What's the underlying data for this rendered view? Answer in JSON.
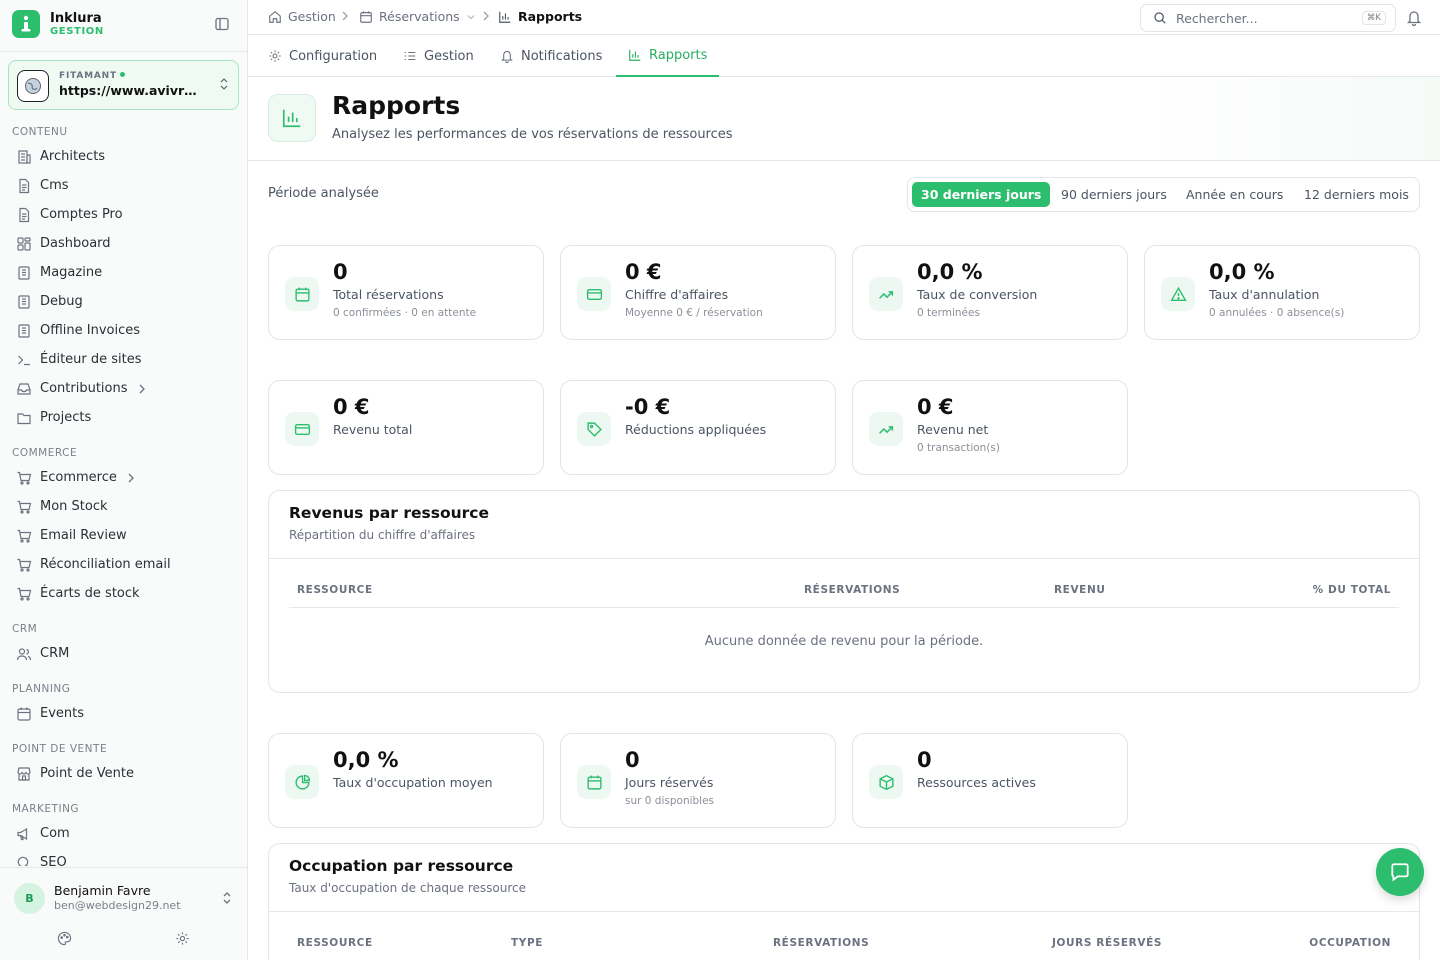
{
  "brand": {
    "name": "Inklura",
    "subtitle": "GESTION"
  },
  "site": {
    "label": "FITAMANT",
    "url": "https://www.avivre.fr"
  },
  "nav": {
    "sections": [
      {
        "title": "CONTENU",
        "items": [
          "Architects",
          "Cms",
          "Comptes Pro",
          "Dashboard",
          "Magazine",
          "Debug",
          "Offline Invoices",
          "Éditeur de sites",
          "Contributions",
          "Projects"
        ]
      },
      {
        "title": "COMMERCE",
        "items": [
          "Ecommerce",
          "Mon Stock",
          "Email Review",
          "Réconciliation email",
          "Écarts de stock"
        ]
      },
      {
        "title": "CRM",
        "items": [
          "CRM"
        ]
      },
      {
        "title": "PLANNING",
        "items": [
          "Events"
        ]
      },
      {
        "title": "POINT DE VENTE",
        "items": [
          "Point de Vente"
        ]
      },
      {
        "title": "MARKETING",
        "items": [
          "Com",
          "SEO"
        ]
      }
    ]
  },
  "user": {
    "initial": "B",
    "name": "Benjamin Favre",
    "email": "ben@webdesign29.net"
  },
  "breadcrumb": {
    "home": "Gestion",
    "section": "Réservations",
    "current": "Rapports"
  },
  "search": {
    "placeholder": "Rechercher...",
    "shortcut": "⌘K"
  },
  "tabs": [
    "Configuration",
    "Gestion",
    "Notifications",
    "Rapports"
  ],
  "header": {
    "title": "Rapports",
    "subtitle": "Analysez les performances de vos réservations de ressources"
  },
  "period": {
    "label": "Période analysée",
    "options": [
      "30 derniers jours",
      "90 derniers jours",
      "Année en cours",
      "12 derniers mois"
    ],
    "selected": "30 derniers jours"
  },
  "stats_row1": [
    {
      "value": "0",
      "label": "Total réservations",
      "sub": "0 confirmées · 0 en attente",
      "icon": "calendar-icon"
    },
    {
      "value": "0 €",
      "label": "Chiffre d'affaires",
      "sub": "Moyenne 0 € / réservation",
      "icon": "credit-card-icon"
    },
    {
      "value": "0,0 %",
      "label": "Taux de conversion",
      "sub": "0 terminées",
      "icon": "trending-up-icon"
    },
    {
      "value": "0,0 %",
      "label": "Taux d'annulation",
      "sub": "0 annulées · 0 absence(s)",
      "icon": "warning-icon"
    }
  ],
  "stats_row2": [
    {
      "value": "0 €",
      "label": "Revenu total",
      "sub": "",
      "icon": "credit-card-icon"
    },
    {
      "value": "-0 €",
      "label": "Réductions appliquées",
      "sub": "",
      "icon": "tag-icon"
    },
    {
      "value": "0 €",
      "label": "Revenu net",
      "sub": "0 transaction(s)",
      "icon": "trending-up-icon"
    }
  ],
  "revenue_panel": {
    "title": "Revenus par ressource",
    "subtitle": "Répartition du chiffre d'affaires",
    "columns": [
      "RESSOURCE",
      "RÉSERVATIONS",
      "REVENU",
      "% DU TOTAL"
    ],
    "empty": "Aucune donnée de revenu pour la période."
  },
  "stats_row3": [
    {
      "value": "0,0 %",
      "label": "Taux d'occupation moyen",
      "sub": "",
      "icon": "pie-chart-icon"
    },
    {
      "value": "0",
      "label": "Jours réservés",
      "sub": "sur 0 disponibles",
      "icon": "calendar-icon"
    },
    {
      "value": "0",
      "label": "Ressources actives",
      "sub": "",
      "icon": "box-icon"
    }
  ],
  "occupancy_panel": {
    "title": "Occupation par ressource",
    "subtitle": "Taux d'occupation de chaque ressource",
    "columns": [
      "RESSOURCE",
      "TYPE",
      "RÉSERVATIONS",
      "JOURS RÉSERVÉS",
      "OCCUPATION"
    ]
  },
  "colors": {
    "accent": "#2dbd6e",
    "accent_light": "#eef8f2",
    "border": "#e2e5e9"
  }
}
